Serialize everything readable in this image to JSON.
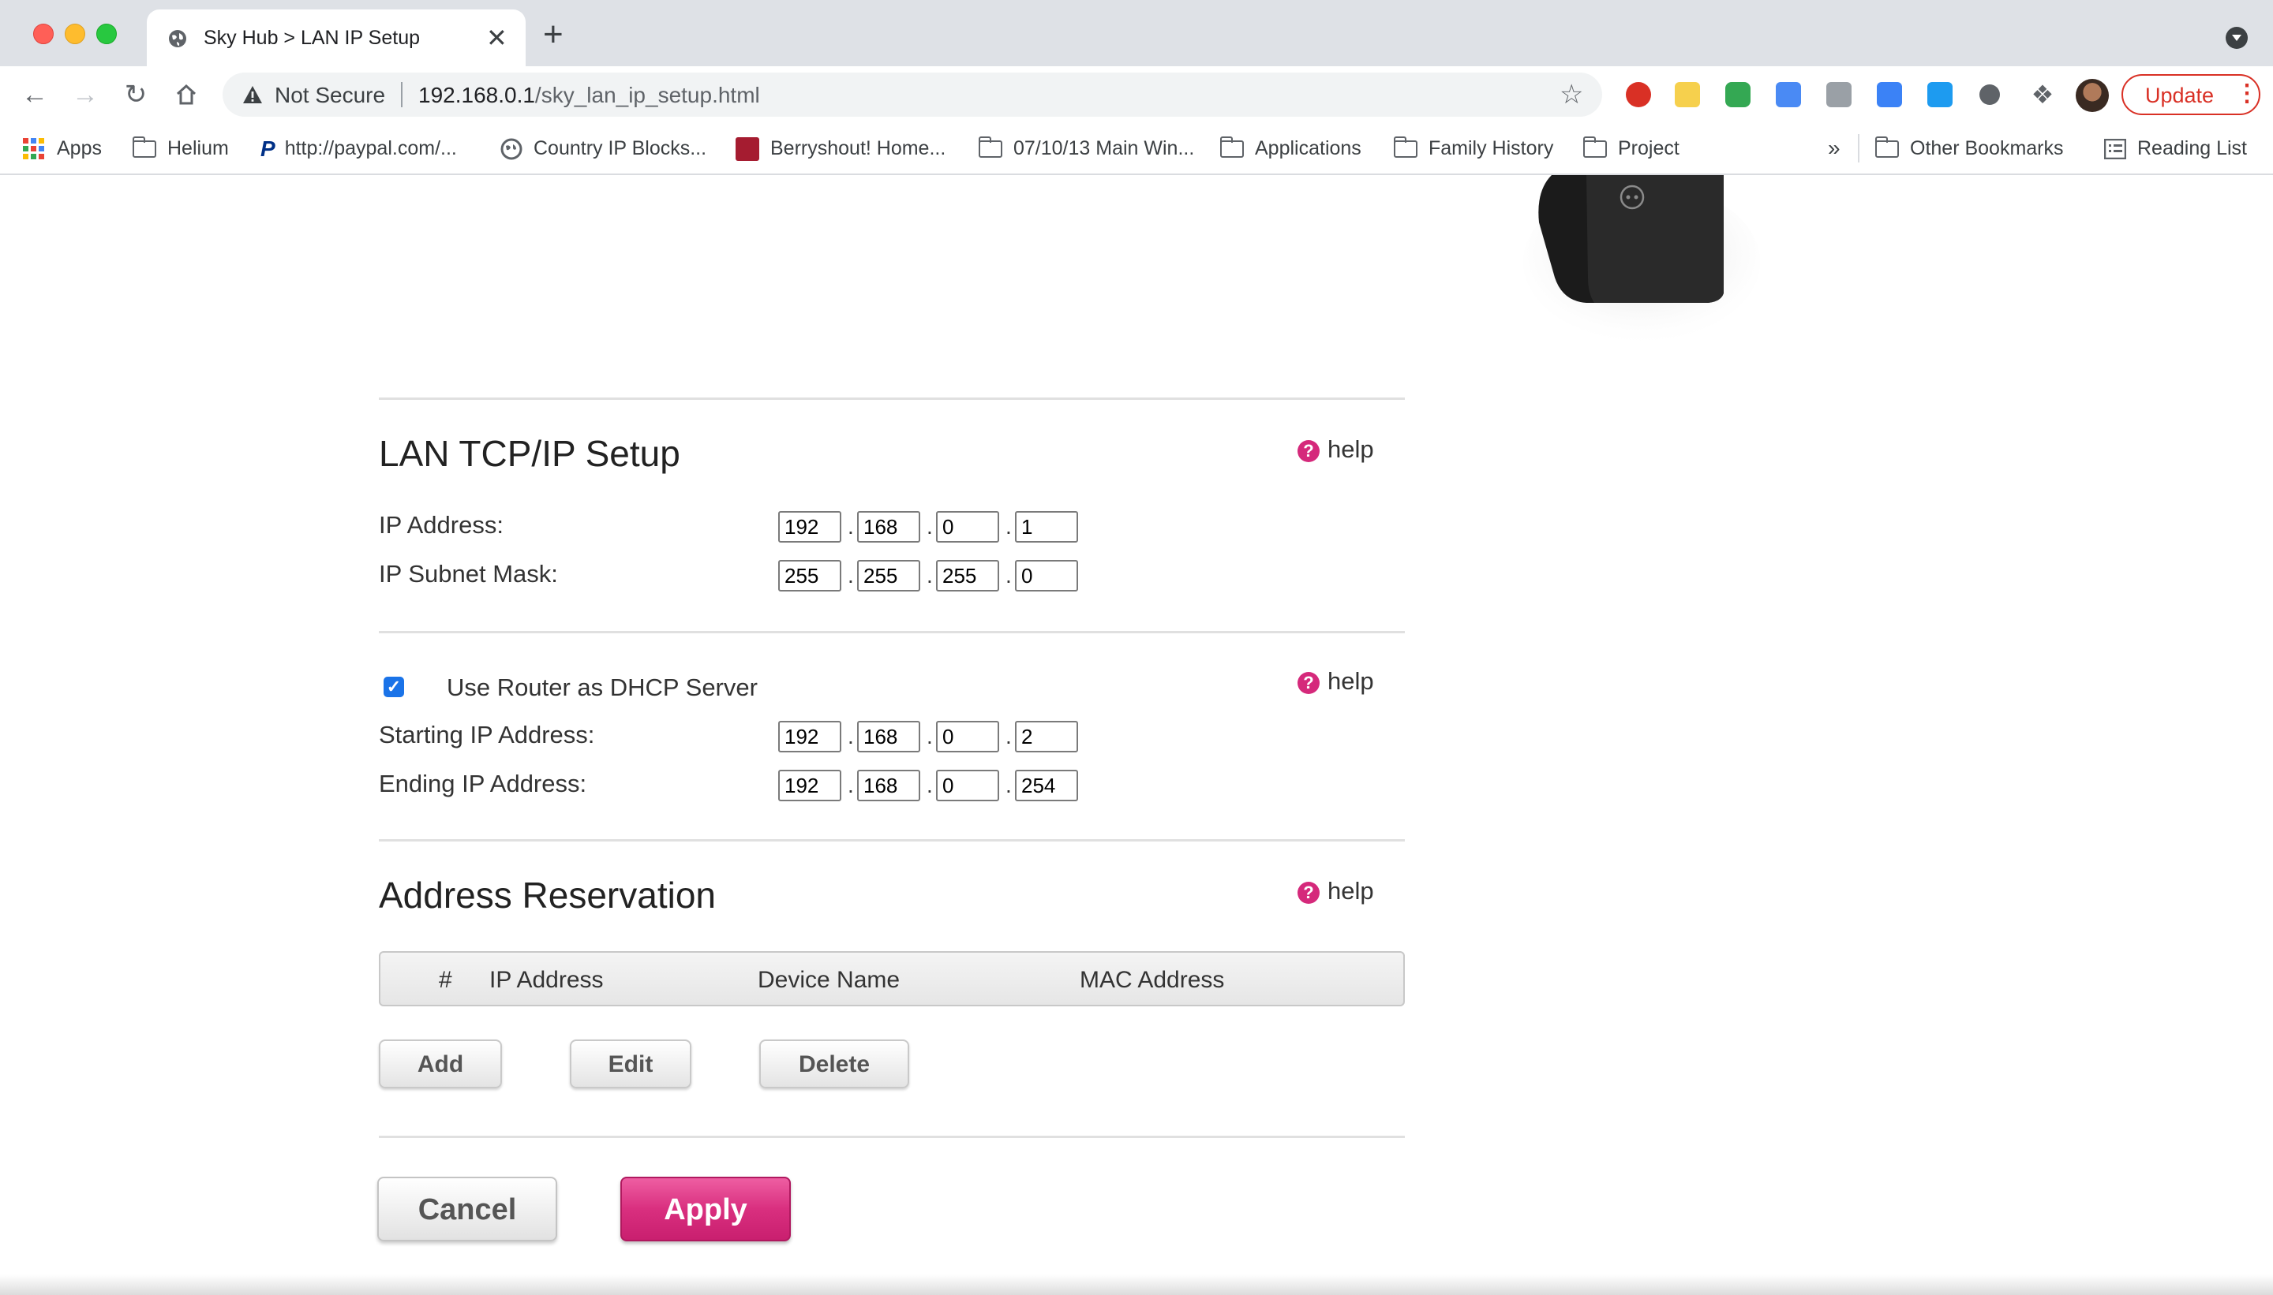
{
  "browser": {
    "tab": {
      "title": "Sky Hub > LAN IP Setup",
      "favicon": "globe-icon"
    },
    "new_tab_symbol": "+",
    "close_symbol": "✕",
    "address_bar": {
      "security_label": "Not Secure",
      "url_host": "192.168.0.1",
      "url_path": "/sky_lan_ip_setup.html"
    },
    "update_label": "Update",
    "extensions": [
      "adblock-icon",
      "highlighter-icon",
      "refresh-ext-icon",
      "dev-ext-icon",
      "code-ext-icon",
      "screenshot-ext-icon",
      "twitter-ext-icon",
      "circle-ext-icon",
      "puzzle-icon"
    ],
    "bookmarks": [
      {
        "label": "Apps",
        "icon": "apps-grid-icon"
      },
      {
        "label": "Helium",
        "icon": "folder-icon"
      },
      {
        "label": "http://paypal.com/...",
        "icon": "paypal-icon"
      },
      {
        "label": "Country IP Blocks...",
        "icon": "globe-icon"
      },
      {
        "label": "Berryshout! Home...",
        "icon": "berryshout-icon"
      },
      {
        "label": "07/10/13 Main Win...",
        "icon": "folder-icon"
      },
      {
        "label": "Applications",
        "icon": "folder-icon"
      },
      {
        "label": "Family History",
        "icon": "folder-icon"
      },
      {
        "label": "Project",
        "icon": "folder-icon"
      }
    ],
    "overflow_label": "»",
    "other_bookmarks": "Other Bookmarks",
    "reading_list": "Reading List"
  },
  "lan_setup": {
    "title": "LAN TCP/IP Setup",
    "help": "help",
    "ip_address": {
      "label": "IP Address:",
      "octets": [
        "192",
        "168",
        "0",
        "1"
      ]
    },
    "subnet_mask": {
      "label": "IP Subnet Mask:",
      "octets": [
        "255",
        "255",
        "255",
        "0"
      ]
    }
  },
  "dhcp": {
    "checkbox_label": "Use Router as DHCP Server",
    "checked": true,
    "help": "help",
    "starting": {
      "label": "Starting IP Address:",
      "octets": [
        "192",
        "168",
        "0",
        "2"
      ]
    },
    "ending": {
      "label": "Ending IP Address:",
      "octets": [
        "192",
        "168",
        "0",
        "254"
      ]
    }
  },
  "reservation": {
    "title": "Address Reservation",
    "help": "help",
    "columns": [
      "#",
      "IP Address",
      "Device Name",
      "MAC Address"
    ],
    "buttons": {
      "add": "Add",
      "edit": "Edit",
      "delete": "Delete"
    }
  },
  "footer": {
    "cancel": "Cancel",
    "apply": "Apply"
  },
  "colors": {
    "accent": "#d5297b",
    "apply": "#d92f7f",
    "checkbox": "#1a73e8"
  }
}
